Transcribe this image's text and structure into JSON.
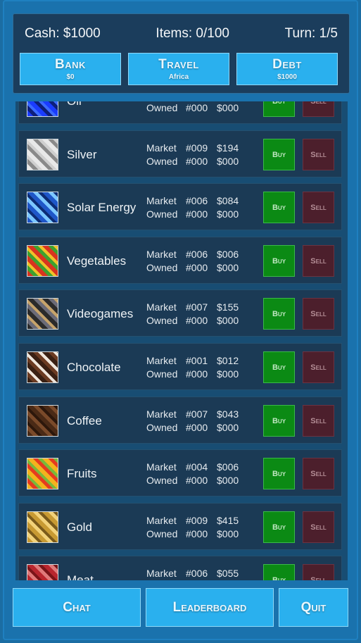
{
  "stats": {
    "cash": "Cash: $1000",
    "items": "Items: 0/100",
    "turn": "Turn: 1/5"
  },
  "top_buttons": [
    {
      "label": "Bank",
      "sub": "$0"
    },
    {
      "label": "Travel",
      "sub": "Africa"
    },
    {
      "label": "Debt",
      "sub": "$1000"
    }
  ],
  "goods": [
    {
      "name": "Oil",
      "market_qty": "",
      "market_price": "",
      "owned_qty": "#000",
      "owned_price": "$000",
      "icon": "oil-barrels-icon",
      "colors": [
        "#1a3cff",
        "#0d1f7a",
        "#3b6bff"
      ]
    },
    {
      "name": "Silver",
      "market_qty": "#009",
      "market_price": "$194",
      "owned_qty": "#000",
      "owned_price": "$000",
      "icon": "silver-bars-icon",
      "colors": [
        "#e8e8e8",
        "#8a8a8a",
        "#cfcfcf"
      ]
    },
    {
      "name": "Solar Energy",
      "market_qty": "#006",
      "market_price": "$084",
      "owned_qty": "#000",
      "owned_price": "$000",
      "icon": "solar-panel-icon",
      "colors": [
        "#1f57c8",
        "#7cc7ff",
        "#0c2c74"
      ]
    },
    {
      "name": "Vegetables",
      "market_qty": "#006",
      "market_price": "$006",
      "owned_qty": "#000",
      "owned_price": "$000",
      "icon": "vegetables-icon",
      "colors": [
        "#d8341f",
        "#3ea12f",
        "#f1c12a"
      ]
    },
    {
      "name": "Videogames",
      "market_qty": "#007",
      "market_price": "$155",
      "owned_qty": "#000",
      "owned_price": "$000",
      "icon": "videogames-icon",
      "colors": [
        "#2b2b2b",
        "#6b6b78",
        "#c6a36a"
      ]
    },
    {
      "name": "Chocolate",
      "market_qty": "#001",
      "market_price": "$012",
      "owned_qty": "#000",
      "owned_price": "$000",
      "icon": "chocolate-icon",
      "colors": [
        "#3a2013",
        "#6b3b22",
        "#efe6dc"
      ]
    },
    {
      "name": "Coffee",
      "market_qty": "#007",
      "market_price": "$043",
      "owned_qty": "#000",
      "owned_price": "$000",
      "icon": "coffee-beans-icon",
      "colors": [
        "#4a2a16",
        "#7a4a2a",
        "#2c170b"
      ]
    },
    {
      "name": "Fruits",
      "market_qty": "#004",
      "market_price": "$006",
      "owned_qty": "#000",
      "owned_price": "$000",
      "icon": "fruits-icon",
      "colors": [
        "#f4b21d",
        "#e53b1f",
        "#79b93a"
      ]
    },
    {
      "name": "Gold",
      "market_qty": "#009",
      "market_price": "$415",
      "owned_qty": "#000",
      "owned_price": "$000",
      "icon": "gold-bars-icon",
      "colors": [
        "#c89a33",
        "#f2d27a",
        "#7a5a1a"
      ]
    },
    {
      "name": "Meat",
      "market_qty": "#006",
      "market_price": "$055",
      "owned_qty": "",
      "owned_price": "",
      "icon": "meat-icon",
      "colors": [
        "#b8262e",
        "#e07a7a",
        "#7a1418"
      ]
    }
  ],
  "labels": {
    "market": "Market",
    "owned": "Owned",
    "buy": "Buy",
    "sell": "Sell"
  },
  "bottom_buttons": [
    "Chat",
    "Leaderboard",
    "Quit"
  ]
}
